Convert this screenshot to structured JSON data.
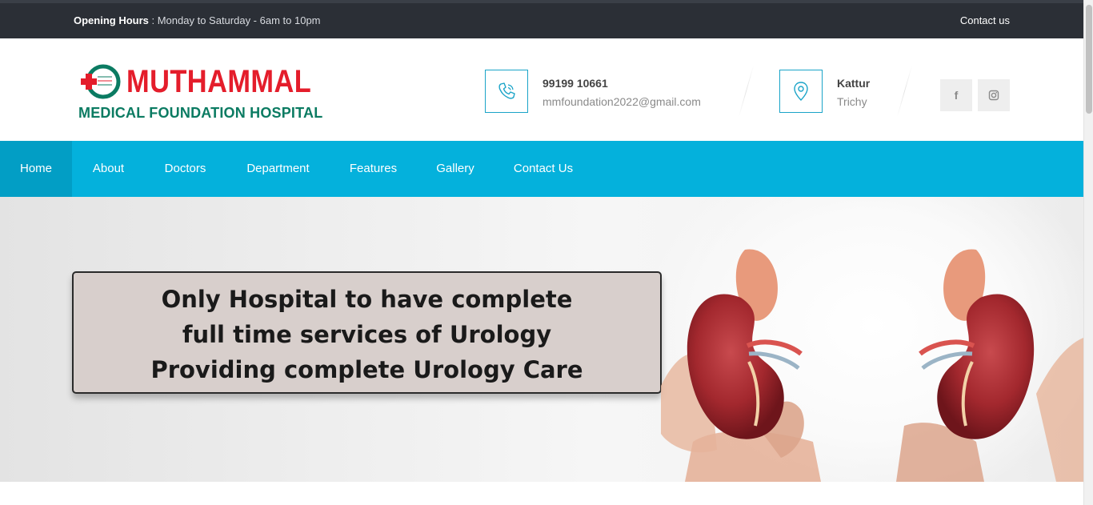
{
  "topbar": {
    "hours_label": "Opening Hours",
    "hours_value": " : Monday to Saturday - 6am to 10pm",
    "contact_link": "Contact us"
  },
  "logo": {
    "name": "MUTHAMMAL",
    "subtitle": "MEDICAL FOUNDATION HOSPITAL",
    "colors": {
      "name": "#e41d2b",
      "subtitle": "#0b7b62"
    }
  },
  "contact_info": {
    "phone": {
      "icon": "phone-icon",
      "number": "99199 10661",
      "email": "mmfoundation2022@gmail.com"
    },
    "location": {
      "icon": "map-pin-icon",
      "area": "Kattur",
      "city": "Trichy"
    }
  },
  "social": [
    {
      "name": "facebook",
      "icon": "f"
    },
    {
      "name": "instagram",
      "icon": "instagram-icon"
    }
  ],
  "nav": {
    "items": [
      {
        "label": "Home",
        "active": true
      },
      {
        "label": "About"
      },
      {
        "label": "Doctors"
      },
      {
        "label": "Department"
      },
      {
        "label": "Features"
      },
      {
        "label": "Gallery"
      },
      {
        "label": "Contact Us"
      }
    ],
    "color": "#04b1dc",
    "active_color": "#029ec5"
  },
  "hero": {
    "banner_lines": [
      "Only Hospital to have complete",
      "full time services of Urology",
      "Providing complete Urology Care"
    ]
  }
}
